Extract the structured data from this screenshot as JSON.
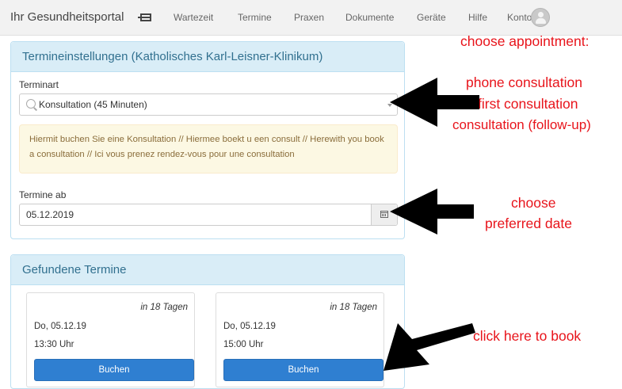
{
  "nav": {
    "brand": "Ihr Gesundheitsportal",
    "items": [
      "Wartezeit",
      "Termine",
      "Praxen",
      "Dokumente",
      "Geräte",
      "Hilfe",
      "Konto"
    ]
  },
  "settings": {
    "title": "Termineinstellungen (Katholisches Karl-Leisner-Klinikum)",
    "type_label": "Terminart",
    "type_value": "Konsultation (45 Minuten)",
    "notice": "Hiermit buchen Sie eine Konsultation // Hiermee boekt u een consult // Herewith you book a consultation // Ici vous prenez rendez-vous pour une consultation",
    "date_label": "Termine ab",
    "date_value": "05.12.2019"
  },
  "found": {
    "title": "Gefundene Termine",
    "cards": [
      {
        "days": "in 18 Tagen",
        "date": "Do, 05.12.19",
        "time": "13:30 Uhr",
        "button": "Buchen"
      },
      {
        "days": "in 18 Tagen",
        "date": "Do, 05.12.19",
        "time": "15:00 Uhr",
        "button": "Buchen"
      }
    ]
  },
  "annotations": {
    "choose_appointment": "choose appointment:",
    "options": [
      "phone consultation",
      "first consultation",
      "consultation (follow-up)"
    ],
    "choose_date": [
      "choose",
      "preferred date"
    ],
    "book": "click here to book"
  },
  "colors": {
    "annotation": "#e8141b",
    "panel_header": "#d9edf7",
    "button": "#2f7fd1",
    "notice_bg": "#fcf8e3"
  }
}
